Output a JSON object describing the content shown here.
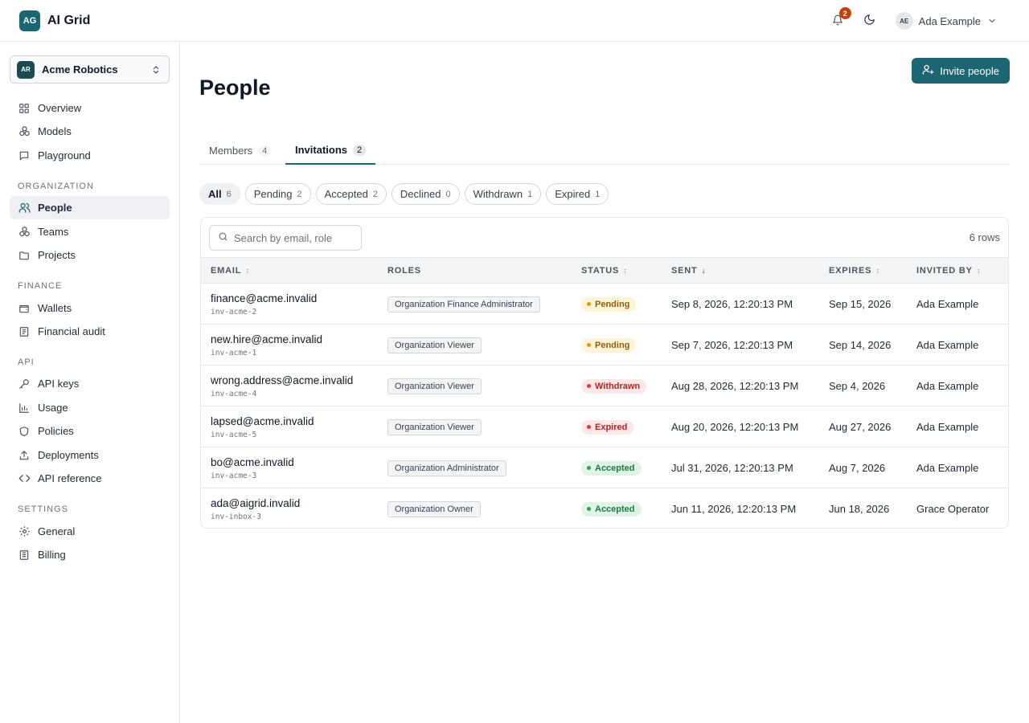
{
  "app": {
    "logo": "AG",
    "name": "AI Grid",
    "notifications_count": "2",
    "user_initials": "AE",
    "user_name": "Ada Example"
  },
  "sidebar": {
    "org_initials": "AR",
    "org_name": "Acme Robotics",
    "top_items": [
      {
        "label": "Overview",
        "icon": "grid-icon"
      },
      {
        "label": "Models",
        "icon": "models-icon"
      },
      {
        "label": "Playground",
        "icon": "chat-icon"
      }
    ],
    "sections": [
      {
        "title": "ORGANIZATION",
        "items": [
          {
            "label": "People",
            "icon": "people-icon",
            "active": true
          },
          {
            "label": "Teams",
            "icon": "teams-icon"
          },
          {
            "label": "Projects",
            "icon": "folder-icon"
          }
        ]
      },
      {
        "title": "FINANCE",
        "items": [
          {
            "label": "Wallets",
            "icon": "wallet-icon"
          },
          {
            "label": "Financial audit",
            "icon": "audit-icon"
          }
        ]
      },
      {
        "title": "API",
        "items": [
          {
            "label": "API keys",
            "icon": "key-icon"
          },
          {
            "label": "Usage",
            "icon": "chart-icon"
          },
          {
            "label": "Policies",
            "icon": "shield-icon"
          },
          {
            "label": "Deployments",
            "icon": "upload-icon"
          },
          {
            "label": "API reference",
            "icon": "code-icon"
          }
        ]
      },
      {
        "title": "SETTINGS",
        "items": [
          {
            "label": "General",
            "icon": "gear-icon"
          },
          {
            "label": "Billing",
            "icon": "receipt-icon"
          }
        ]
      }
    ]
  },
  "main": {
    "title": "People",
    "invite_label": "Invite people",
    "tabs": [
      {
        "label": "Members",
        "count": "4",
        "active": false
      },
      {
        "label": "Invitations",
        "count": "2",
        "active": true
      }
    ],
    "filters": [
      {
        "label": "All",
        "count": "6",
        "active": true
      },
      {
        "label": "Pending",
        "count": "2"
      },
      {
        "label": "Accepted",
        "count": "2"
      },
      {
        "label": "Declined",
        "count": "0"
      },
      {
        "label": "Withdrawn",
        "count": "1"
      },
      {
        "label": "Expired",
        "count": "1"
      }
    ],
    "search_placeholder": "Search by email, role",
    "row_count": "6 rows",
    "columns": [
      "EMAIL",
      "ROLES",
      "STATUS",
      "SENT",
      "EXPIRES",
      "INVITED BY"
    ],
    "rows": [
      {
        "email": "finance@acme.invalid",
        "id": "inv-acme-2",
        "role": "Organization Finance Administrator",
        "status": "Pending",
        "sent": "Sep 8, 2026, 12:20:13 PM",
        "expires": "Sep 15, 2026",
        "invited_by": "Ada Example"
      },
      {
        "email": "new.hire@acme.invalid",
        "id": "inv-acme-1",
        "role": "Organization Viewer",
        "status": "Pending",
        "sent": "Sep 7, 2026, 12:20:13 PM",
        "expires": "Sep 14, 2026",
        "invited_by": "Ada Example"
      },
      {
        "email": "wrong.address@acme.invalid",
        "id": "inv-acme-4",
        "role": "Organization Viewer",
        "status": "Withdrawn",
        "sent": "Aug 28, 2026, 12:20:13 PM",
        "expires": "Sep 4, 2026",
        "invited_by": "Ada Example"
      },
      {
        "email": "lapsed@acme.invalid",
        "id": "inv-acme-5",
        "role": "Organization Viewer",
        "status": "Expired",
        "sent": "Aug 20, 2026, 12:20:13 PM",
        "expires": "Aug 27, 2026",
        "invited_by": "Ada Example"
      },
      {
        "email": "bo@acme.invalid",
        "id": "inv-acme-3",
        "role": "Organization Administrator",
        "status": "Accepted",
        "sent": "Jul 31, 2026, 12:20:13 PM",
        "expires": "Aug 7, 2026",
        "invited_by": "Ada Example"
      },
      {
        "email": "ada@aigrid.invalid",
        "id": "inv-inbox-3",
        "role": "Organization Owner",
        "status": "Accepted",
        "sent": "Jun 11, 2026, 12:20:13 PM",
        "expires": "Jun 18, 2026",
        "invited_by": "Grace Operator"
      }
    ]
  },
  "colors": {
    "accent": "#1b6672",
    "pending_bg": "#fdf3d7",
    "pending_fg": "#92600a",
    "pending_dot": "#d99a1b",
    "withdrawn_bg": "#fde7e7",
    "withdrawn_fg": "#b42323",
    "withdrawn_dot": "#dc3b3b",
    "expired_bg": "#fde7e7",
    "expired_fg": "#b42323",
    "expired_dot": "#dc3b3b",
    "accepted_bg": "#dff3e6",
    "accepted_fg": "#1e7a43",
    "accepted_dot": "#2f9e58"
  }
}
